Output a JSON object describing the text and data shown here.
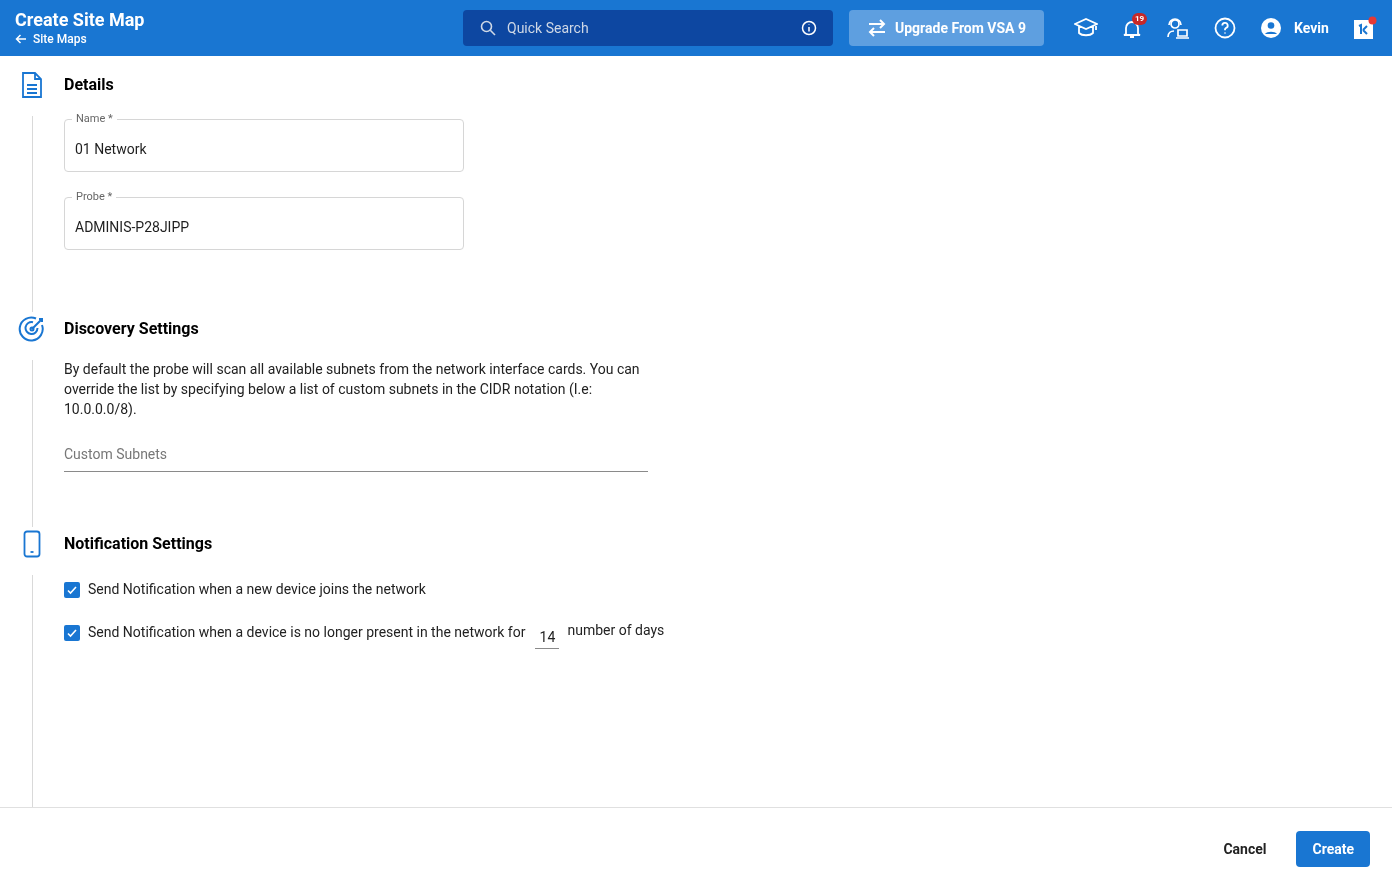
{
  "header": {
    "title": "Create Site Map",
    "back_link": "Site Maps",
    "search": {
      "placeholder": "Quick Search"
    },
    "upgrade_button": "Upgrade From VSA 9",
    "notification_count": "19",
    "user_name": "Kevin"
  },
  "sections": [
    {
      "kind": "details",
      "title": "Details",
      "fields": [
        {
          "label": "Name *",
          "value": "01 Network"
        },
        {
          "label": "Probe *",
          "value": "ADMINIS-P28JIPP"
        }
      ]
    },
    {
      "kind": "discovery",
      "title": "Discovery Settings",
      "description": "By default the probe will scan all available subnets from the network interface cards. You can override the list by specifying below a list of custom subnets in the CIDR notation (I.e: 10.0.0.0/8).",
      "field": {
        "placeholder": "Custom Subnets"
      }
    },
    {
      "kind": "notifications",
      "title": "Notification Settings",
      "options": [
        {
          "label": "Send Notification when a new device joins the network",
          "checked": true
        },
        {
          "label": "Send Notification when a device is no longer present in the network for",
          "checked": true,
          "days_value": "14",
          "suffix": "number of days"
        }
      ]
    }
  ],
  "footer": {
    "buttons": [
      {
        "label": "Cancel",
        "kind": "text"
      },
      {
        "label": "Create",
        "kind": "primary"
      }
    ]
  }
}
